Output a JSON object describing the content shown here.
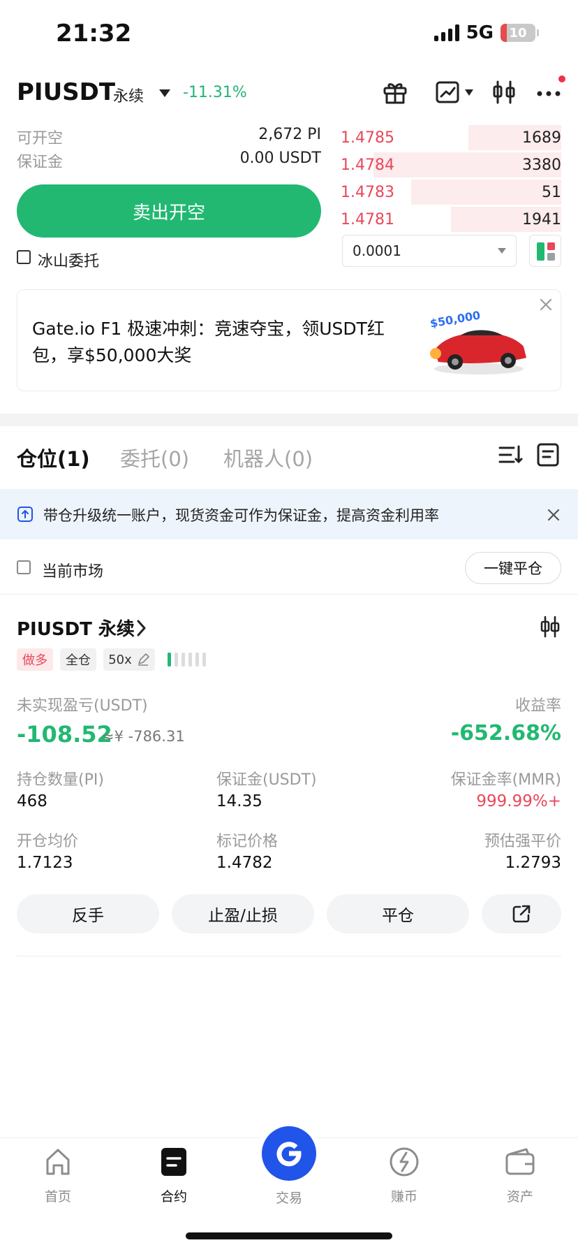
{
  "status_bar": {
    "time": "21:32",
    "network": "5G",
    "battery": "10"
  },
  "header": {
    "pair": "PIUSDT",
    "contract_type": "永续",
    "change": "-11.31%"
  },
  "order_panel": {
    "available_label": "可开空",
    "available_value": "2,672 PI",
    "margin_label": "保证金",
    "margin_value": "0.00 USDT",
    "sell_button": "卖出开空",
    "iceberg_label": "冰山委托"
  },
  "order_book": {
    "asks": [
      {
        "price": "1.4785",
        "qty": "1689",
        "depth": 0.42
      },
      {
        "price": "1.4784",
        "qty": "3380",
        "depth": 0.85
      },
      {
        "price": "1.4783",
        "qty": "51",
        "depth": 0.68
      },
      {
        "price": "1.4781",
        "qty": "1941",
        "depth": 0.5
      }
    ],
    "step": "0.0001"
  },
  "banner": {
    "text": "Gate.io F1 极速冲刺：竞速夺宝，领USDT红包，享$50,000大奖",
    "badge": "$50,000"
  },
  "tabs": [
    {
      "label": "仓位(1)",
      "active": true
    },
    {
      "label": "委托(0)",
      "active": false
    },
    {
      "label": "机器人(0)",
      "active": false
    }
  ],
  "info_bar": {
    "text": "带仓升级统一账户，现货资金可作为保证金，提高资金利用率"
  },
  "filter": {
    "current_market_label": "当前市场",
    "close_all_button": "一键平仓"
  },
  "position": {
    "title": "PIUSDT 永续",
    "tags": {
      "side": "做多",
      "mode": "全仓",
      "leverage": "50x"
    },
    "pnl_label": "未实现盈亏(USDT)",
    "pnl_value": "-108.52",
    "pnl_cny": "≈¥ -786.31",
    "roe_label": "收益率",
    "roe_value": "-652.68%",
    "size_label": "持仓数量(PI)",
    "size_value": "468",
    "margin_label": "保证金(USDT)",
    "margin_value": "14.35",
    "mmr_label": "保证金率(MMR)",
    "mmr_value": "999.99%+",
    "entry_label": "开仓均价",
    "entry_value": "1.7123",
    "mark_label": "标记价格",
    "mark_value": "1.4782",
    "liq_label": "预估强平价",
    "liq_value": "1.2793",
    "buttons": {
      "reverse": "反手",
      "tpsl": "止盈/止损",
      "close": "平仓"
    }
  },
  "bottom_nav": [
    {
      "label": "首页",
      "icon": "home-icon",
      "active": false
    },
    {
      "label": "合约",
      "icon": "contract-icon",
      "active": true
    },
    {
      "label": "交易",
      "icon": "trade-icon",
      "active": false
    },
    {
      "label": "赚币",
      "icon": "earn-icon",
      "active": false
    },
    {
      "label": "资产",
      "icon": "wallet-icon",
      "active": false
    }
  ],
  "colors": {
    "green": "#22b872",
    "red": "#e8485a",
    "blue": "#2154e8"
  }
}
